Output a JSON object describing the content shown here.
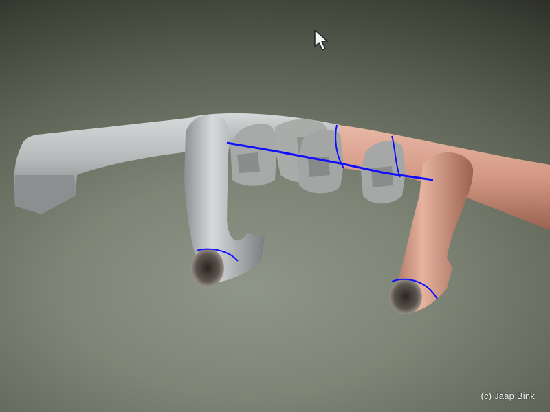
{
  "scene": {
    "subject": "3d-model-viewport",
    "colors": {
      "background_light": "#8f968a",
      "background_dark": "#24261f",
      "model_grey": "#b9bcbd",
      "model_grey_dark": "#6f7274",
      "model_skin": "#d9a08a",
      "model_skin_dark": "#8f5a48",
      "selection_outline": "#1010ff"
    }
  },
  "cursor": {
    "icon": "arrow-cursor-icon"
  },
  "watermark": {
    "text": "(c) Jaap Bink"
  }
}
